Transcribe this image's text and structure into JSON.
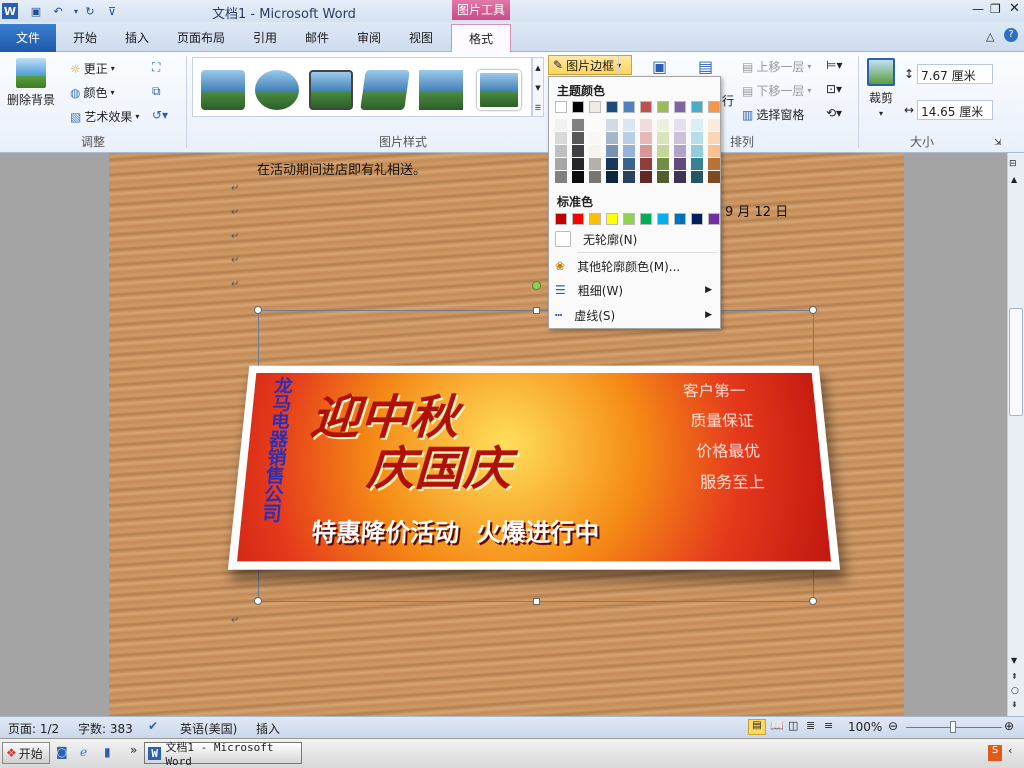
{
  "window": {
    "title": "文档1 - Microsoft Word"
  },
  "context_tab": {
    "label": "图片工具"
  },
  "tabs": [
    "文件",
    "开始",
    "插入",
    "页面布局",
    "引用",
    "邮件",
    "审阅",
    "视图",
    "格式"
  ],
  "ribbon": {
    "adjust": {
      "remove_bg": "删除背景",
      "corrections": "更正",
      "color": "颜色",
      "artistic": "艺术效果",
      "label": "调整"
    },
    "styles": {
      "label": "图片样式",
      "border_btn": "图片边框"
    },
    "arrange": {
      "bring_forward": "上移一层",
      "send_backward": "下移一层",
      "selection_pane": "选择窗格",
      "label": "排列",
      "wrap_partial": "行"
    },
    "size": {
      "crop": "裁剪",
      "height": "7.67 厘米",
      "width": "14.65 厘米",
      "label": "大小"
    }
  },
  "dropdown": {
    "theme_colors_label": "主题颜色",
    "standard_colors_label": "标准色",
    "no_outline": "无轮廓(N)",
    "more_colors": "其他轮廓颜色(M)...",
    "weight": "粗细(W)",
    "dashes": "虚线(S)",
    "theme_row": [
      "#ffffff",
      "#000000",
      "#eeece1",
      "#1f497d",
      "#4f81bd",
      "#c0504d",
      "#9bbb59",
      "#8064a2",
      "#4bacc6",
      "#f79646"
    ],
    "standard_row": [
      "#c00000",
      "#ff0000",
      "#ffc000",
      "#ffff00",
      "#92d050",
      "#00b050",
      "#00b0f0",
      "#0070c0",
      "#002060",
      "#7030a0"
    ]
  },
  "document": {
    "line1": "在活动期间进店即有礼相送。",
    "date": "9 月 12 日",
    "banner": {
      "title_line1": "迎中秋",
      "title_line2": "庆国庆",
      "company": "龙马电器销售公司",
      "slogan": "特惠降价活动  火爆进行中",
      "side_tags": [
        "客户第一",
        "质量保证",
        "价格最优",
        "服务至上"
      ]
    }
  },
  "status": {
    "page": "页面: 1/2",
    "words": "字数: 383",
    "language": "英语(美国)",
    "mode": "插入",
    "zoom": "100%"
  },
  "taskbar": {
    "start": "开始",
    "task": "文档1 - Microsoft Word"
  }
}
